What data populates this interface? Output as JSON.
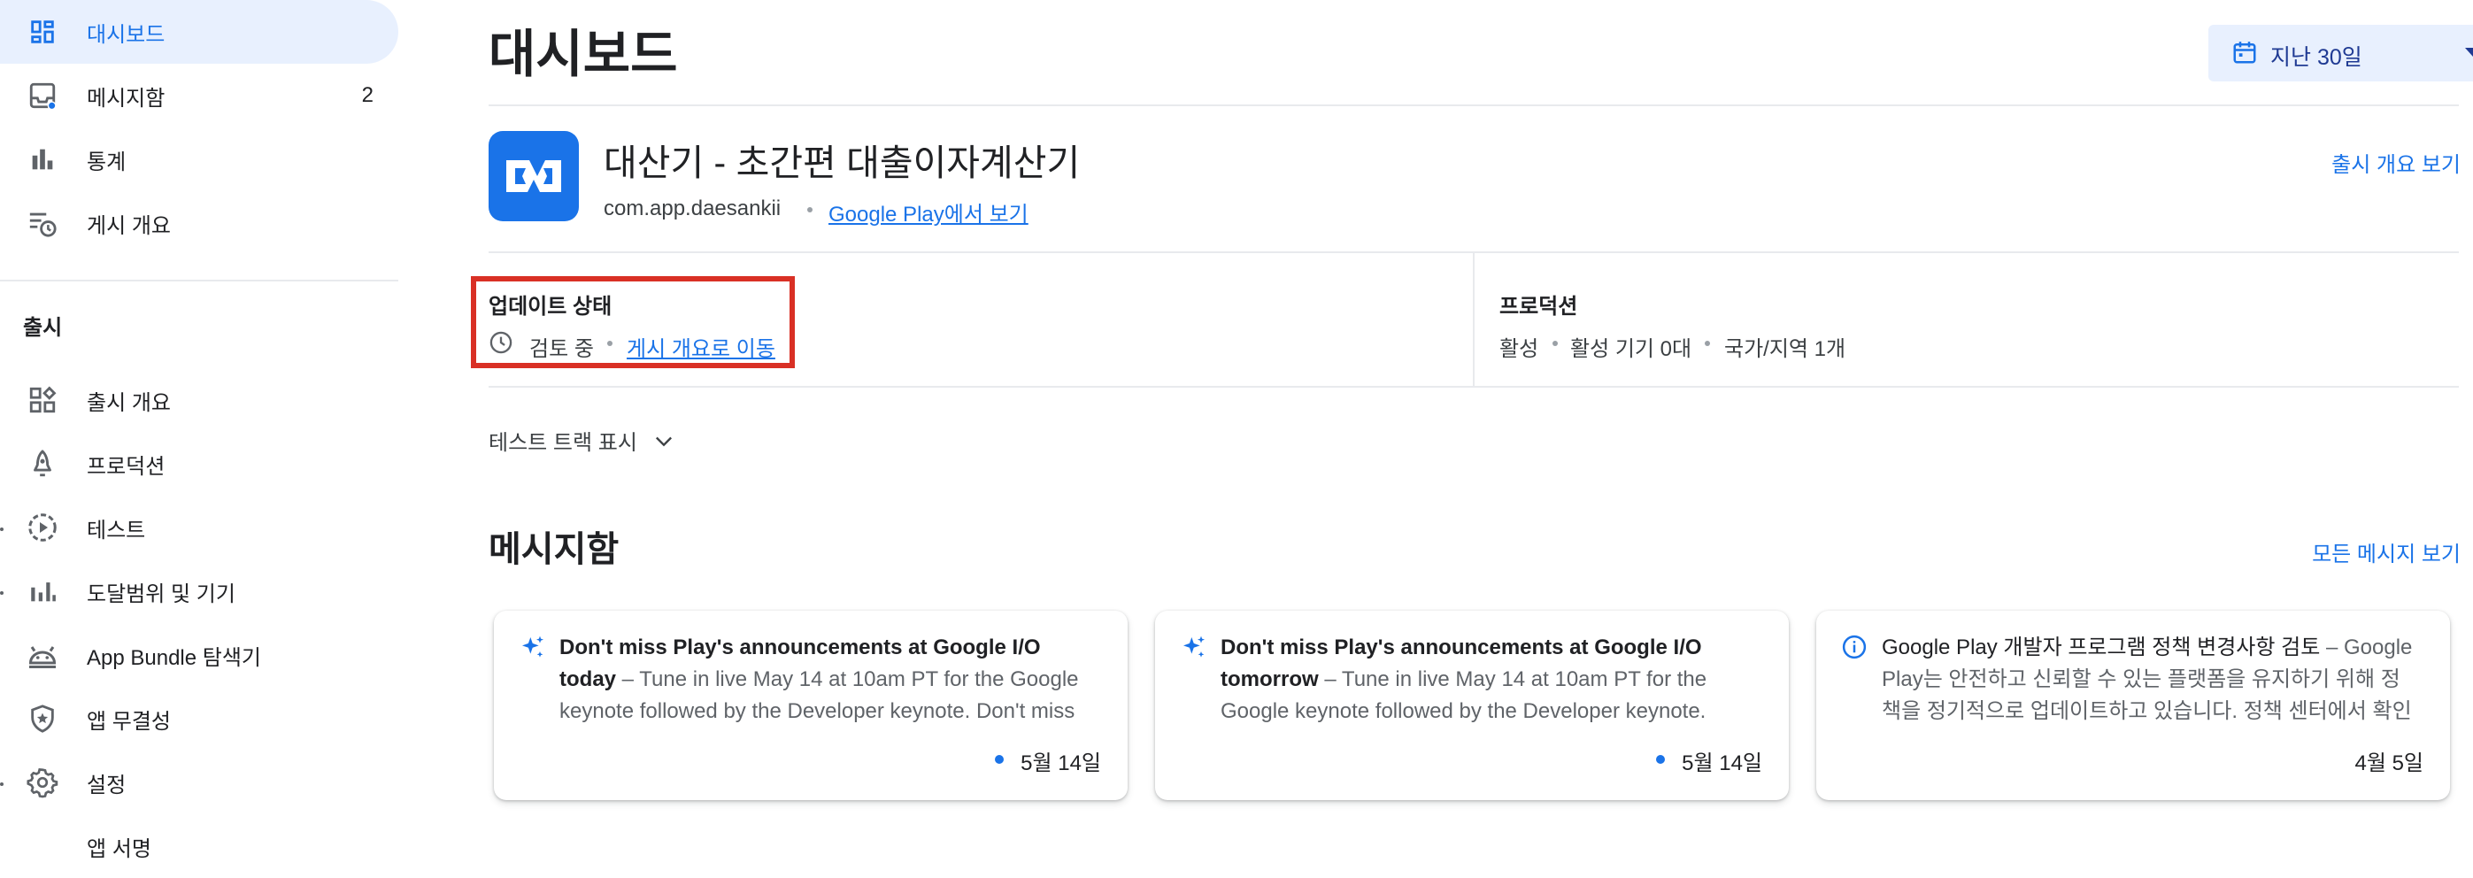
{
  "sidebar": {
    "items": [
      {
        "label": "대시보드",
        "icon": "dashboard-icon"
      },
      {
        "label": "메시지함",
        "icon": "inbox-icon",
        "count": "2"
      },
      {
        "label": "통계",
        "icon": "bar-chart-icon"
      },
      {
        "label": "게시 개요",
        "icon": "schedule-list-icon"
      }
    ],
    "section_heading": "출시",
    "release_items": [
      {
        "label": "출시 개요",
        "icon": "release-overview-icon"
      },
      {
        "label": "프로덕션",
        "icon": "rocket-icon"
      },
      {
        "label": "테스트",
        "icon": "test-play-icon"
      },
      {
        "label": "도달범위 및 기기",
        "icon": "reach-chart-icon"
      },
      {
        "label": "App Bundle 탐색기",
        "icon": "android-icon"
      },
      {
        "label": "앱 무결성",
        "icon": "shield-star-icon"
      },
      {
        "label": "설정",
        "icon": "gear-icon"
      },
      {
        "label": "앱 서명",
        "icon": ""
      }
    ]
  },
  "header": {
    "title": "대시보드",
    "date_range": "지난 30일"
  },
  "app": {
    "name": "대산기 - 초간편 대출이자계산기",
    "package": "com.app.daesankii",
    "play_link": "Google Play에서 보기",
    "release_overview_link": "출시 개요 보기"
  },
  "update_status": {
    "label": "업데이트 상태",
    "status": "검토 중",
    "link": "게시 개요로 이동"
  },
  "production": {
    "label": "프로덕션",
    "status": "활성",
    "devices": "활성 기기 0대",
    "countries": "국가/지역 1개"
  },
  "test_tracks": {
    "label": "테스트 트랙 표시"
  },
  "messages": {
    "title": "메시지함",
    "view_all": "모든 메시지 보기",
    "cards": [
      {
        "icon": "sparkle-icon",
        "title": "Don't miss Play's announcements at Google I/O today",
        "body": " – Tune in live May 14 at 10am PT for the Google keynote followed by the Developer keynote. Don't miss it.",
        "date": "5월 14일",
        "unread": true
      },
      {
        "icon": "sparkle-icon",
        "title": "Don't miss Play's announcements at Google I/O tomorrow",
        "body": " – Tune in live May 14 at 10am PT for the Google keynote followed by the Developer keynote. Don't miss it.",
        "date": "5월 14일",
        "unread": true
      },
      {
        "icon": "info-icon",
        "title": "Google Play 개발자 프로그램 정책 변경사항 검토",
        "body": " – Google Play는 안전하고 신뢰할 수 있는 플랫폼을 유지하기 위해 정책을 정기적으로 업데이트하고 있습니다. 정책 센터에서 확인하세요.",
        "date": "4월 5일",
        "unread": false
      }
    ]
  },
  "colors": {
    "accent": "#1a73e8",
    "active_nav_bg": "#e8f0fe",
    "highlight_border": "#d93025"
  }
}
